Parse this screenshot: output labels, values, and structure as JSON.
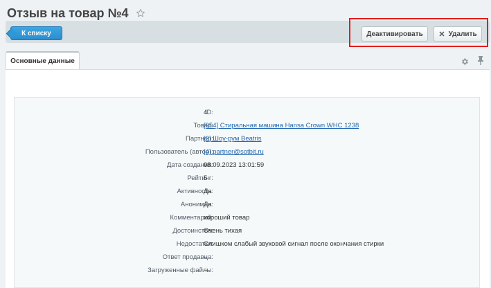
{
  "header": {
    "title": "Отзыв на товар №4"
  },
  "toolbar": {
    "back_label": "К списку",
    "deactivate_label": "Деактивировать",
    "delete_label": "Удалить"
  },
  "tabs": [
    {
      "label": "Основные данные"
    }
  ],
  "colors": {
    "accent": "#2a8dd0",
    "highlight": "#e21c1c",
    "link": "#2067b0"
  },
  "icons": [
    "star-icon",
    "gear-icon",
    "pin-icon",
    "x-icon"
  ],
  "fields": [
    {
      "label": "ID:",
      "value": "4",
      "link": false
    },
    {
      "label": "Товар:",
      "value": "[954] Стиральная машина Hansa Crown WHC 1238",
      "link": true
    },
    {
      "label": "Партнер:",
      "value": "[2] Шоу-рум Beatris",
      "link": true
    },
    {
      "label": "Пользователь (автор):",
      "value": "[4] partner@sotbit.ru",
      "link": true
    },
    {
      "label": "Дата создания:",
      "value": "08.09.2023 13:01:59",
      "link": false
    },
    {
      "label": "Рейтинг:",
      "value": "5",
      "link": false
    },
    {
      "label": "Активность:",
      "value": "Да",
      "link": false
    },
    {
      "label": "Анонимно:",
      "value": "Да",
      "link": false
    },
    {
      "label": "Комментарий:",
      "value": "хороший товар",
      "link": false
    },
    {
      "label": "Достоинства:",
      "value": "Очень тихая",
      "link": false
    },
    {
      "label": "Недостатки:",
      "value": "Слишком слабый звуковой сигнал после окончания стирки",
      "link": false
    },
    {
      "label": "Ответ продавца:",
      "value": "–",
      "link": false
    },
    {
      "label": "Загруженные файлы:",
      "value": "–",
      "link": false
    }
  ]
}
